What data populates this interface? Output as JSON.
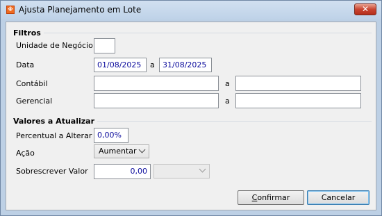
{
  "window": {
    "title": "Ajusta Planejamento em Lote",
    "close_glyph": "✕"
  },
  "filtros": {
    "title": "Filtros",
    "unidade_label": "Unidade de Negócio",
    "unidade_value": "",
    "data_label": "Data",
    "data_from": "01/08/2025",
    "data_sep": "a",
    "data_to": "31/08/2025",
    "contabil_label": "Contábil",
    "contabil_from": "",
    "contabil_sep": "a",
    "contabil_to": "",
    "gerencial_label": "Gerencial",
    "gerencial_from": "",
    "gerencial_sep": "a",
    "gerencial_to": ""
  },
  "valores": {
    "title": "Valores a Atualizar",
    "percentual_label": "Percentual a Alterar",
    "percentual_value": "0,00%",
    "acao_label": "Ação",
    "acao_value": "Aumentar",
    "sobrescrever_label": "Sobrescrever Valor",
    "sobrescrever_value": "0,00",
    "sobrescrever_option": ""
  },
  "buttons": {
    "confirmar_mnemonic": "C",
    "confirmar_rest": "onfirmar",
    "cancelar_label": "Cancelar"
  },
  "colors": {
    "field_text": "#0a0a9c",
    "close_button": "#c94531"
  }
}
